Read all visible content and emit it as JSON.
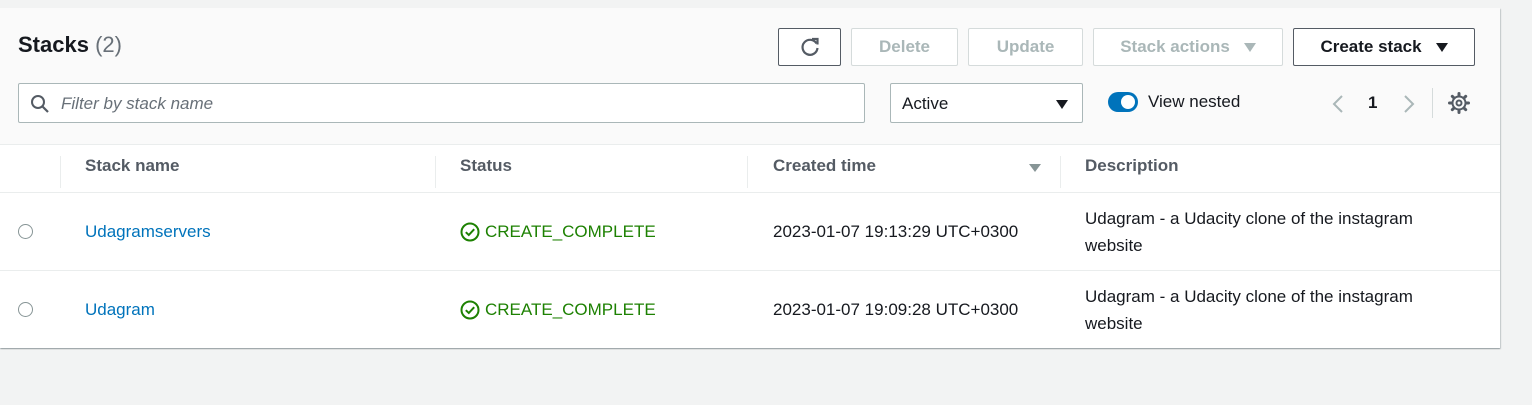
{
  "header": {
    "title": "Stacks",
    "count": "(2)",
    "buttons": {
      "delete": "Delete",
      "update": "Update",
      "stack_actions": "Stack actions",
      "create_stack": "Create stack"
    },
    "search": {
      "placeholder": "Filter by stack name",
      "value": ""
    },
    "filter_select": {
      "value": "Active"
    },
    "view_nested": {
      "label": "View nested",
      "enabled": true
    },
    "pagination": {
      "page": "1"
    }
  },
  "table": {
    "columns": [
      "Stack name",
      "Status",
      "Created time",
      "Description"
    ],
    "sorted_column": "Created time",
    "rows": [
      {
        "name": "Udagramservers",
        "status": "CREATE_COMPLETE",
        "created": "2023-01-07 19:13:29 UTC+0300",
        "description": "Udagram - a Udacity clone of the instagram website"
      },
      {
        "name": "Udagram",
        "status": "CREATE_COMPLETE",
        "created": "2023-01-07 19:09:28 UTC+0300",
        "description": "Udagram - a Udacity clone of the instagram website"
      }
    ]
  },
  "colors": {
    "link": "#0073bb",
    "success": "#1d8102",
    "toggle_on": "#0073bb",
    "disabled_text": "#aab7b8"
  },
  "icons": [
    "refresh-icon",
    "caret-down-icon",
    "search-icon",
    "chevron-left-icon",
    "chevron-right-icon",
    "settings-icon",
    "status-success-icon",
    "sort-down-icon"
  ]
}
